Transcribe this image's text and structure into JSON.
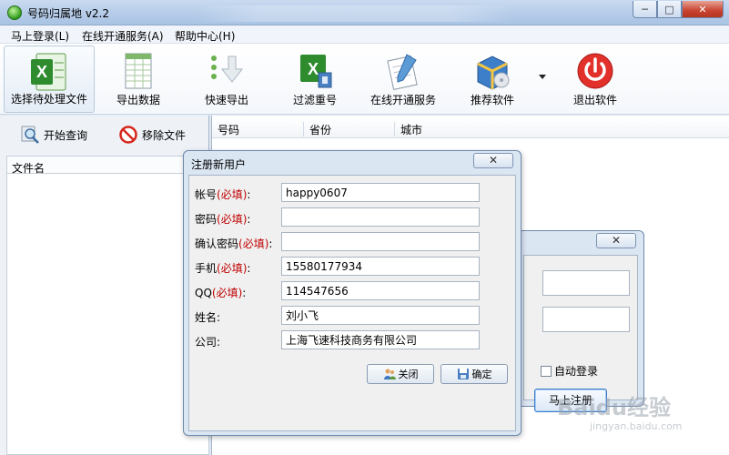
{
  "window": {
    "title": "号码归属地 v2.2",
    "buttons": {
      "minimize": "─",
      "maximize": "□",
      "close": "✕"
    }
  },
  "menu": [
    "马上登录(L)",
    "在线开通服务(A)",
    "帮助中心(H)"
  ],
  "toolbar": [
    {
      "label": "选择待处理文件",
      "icon": "excel-file-icon"
    },
    {
      "label": "导出数据",
      "icon": "spreadsheet-icon"
    },
    {
      "label": "快速导出",
      "icon": "download-arrow-icon"
    },
    {
      "label": "过滤重号",
      "icon": "excel-filter-icon"
    },
    {
      "label": "在线开通服务",
      "icon": "document-pen-icon"
    },
    {
      "label": "推荐软件",
      "icon": "software-box-icon"
    },
    {
      "label": "退出软件",
      "icon": "power-icon"
    }
  ],
  "left": {
    "query_btn": "开始查询",
    "remove_btn": "移除文件",
    "column": "文件名"
  },
  "grid": {
    "columns": [
      "号码",
      "省份",
      "城市"
    ]
  },
  "register": {
    "title": "注册新用户",
    "close": "✕",
    "required_tag": "(必填)",
    "fields": [
      {
        "label": "帐号",
        "required": true,
        "value": "happy0607"
      },
      {
        "label": "密码",
        "required": true,
        "value": ""
      },
      {
        "label": "确认密码",
        "required": true,
        "value": ""
      },
      {
        "label": "手机",
        "required": true,
        "value": "15580177934"
      },
      {
        "label": "QQ",
        "required": true,
        "value": "114547656"
      },
      {
        "label": "姓名",
        "required": false,
        "value": "刘小飞"
      },
      {
        "label": "公司",
        "required": false,
        "value": "上海飞速科技商务有限公司"
      }
    ],
    "close_btn": "关闭",
    "ok_btn": "确定"
  },
  "login": {
    "close": "✕",
    "auto_login": "自动登录",
    "register_btn": "马上注册"
  },
  "watermark": {
    "main": "Baidu经验",
    "sub": "jingyan.baidu.com"
  }
}
